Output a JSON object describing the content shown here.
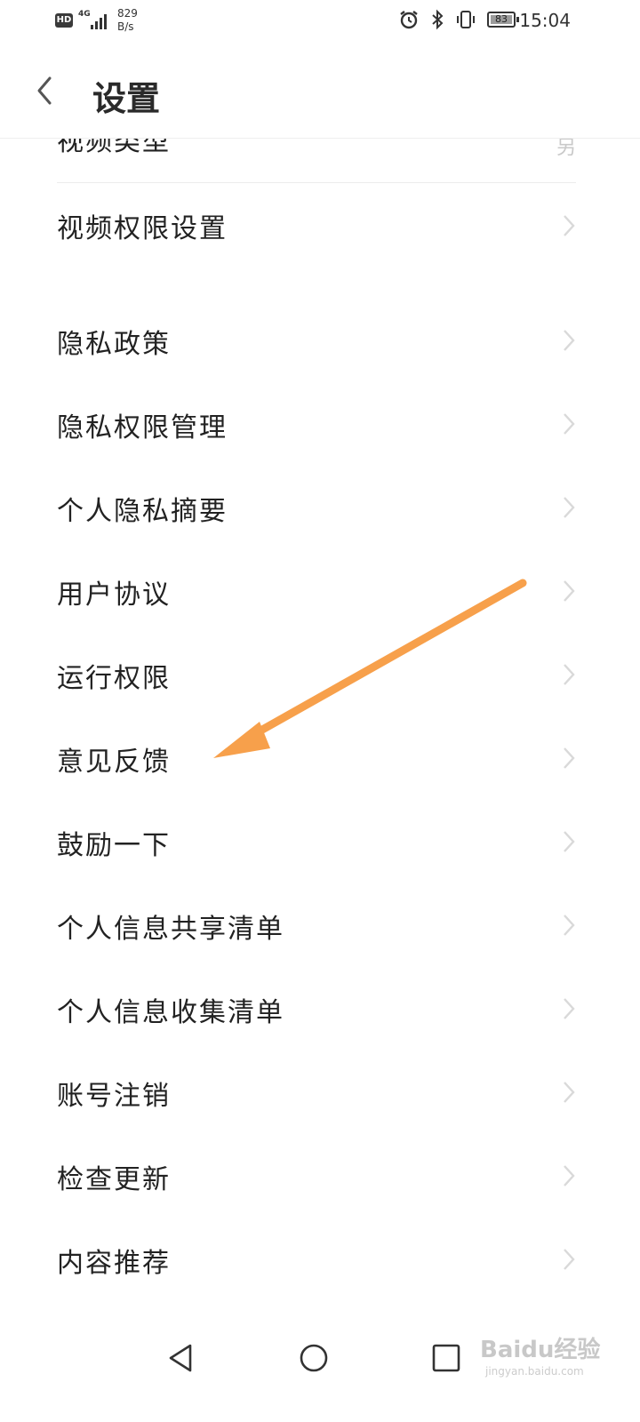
{
  "status_bar": {
    "hd": "HD",
    "network": "4G",
    "speed_value": "829",
    "speed_unit": "B/s",
    "battery": "83",
    "time": "15:04"
  },
  "header": {
    "title": "设置"
  },
  "partial_row": {
    "label": "视频类型",
    "value": "另"
  },
  "items": [
    {
      "label": "视频权限设置"
    },
    {
      "label": "隐私政策"
    },
    {
      "label": "隐私权限管理"
    },
    {
      "label": "个人隐私摘要"
    },
    {
      "label": "用户协议"
    },
    {
      "label": "运行权限"
    },
    {
      "label": "意见反馈"
    },
    {
      "label": "鼓励一下"
    },
    {
      "label": "个人信息共享清单"
    },
    {
      "label": "个人信息收集清单"
    },
    {
      "label": "账号注销"
    },
    {
      "label": "检查更新"
    },
    {
      "label": "内容推荐"
    }
  ],
  "watermark": {
    "brand": "Baidu经验",
    "domain": "jingyan.baidu.com"
  },
  "colors": {
    "arrow": "#f7a04b",
    "chevron": "#d9d9d9"
  }
}
